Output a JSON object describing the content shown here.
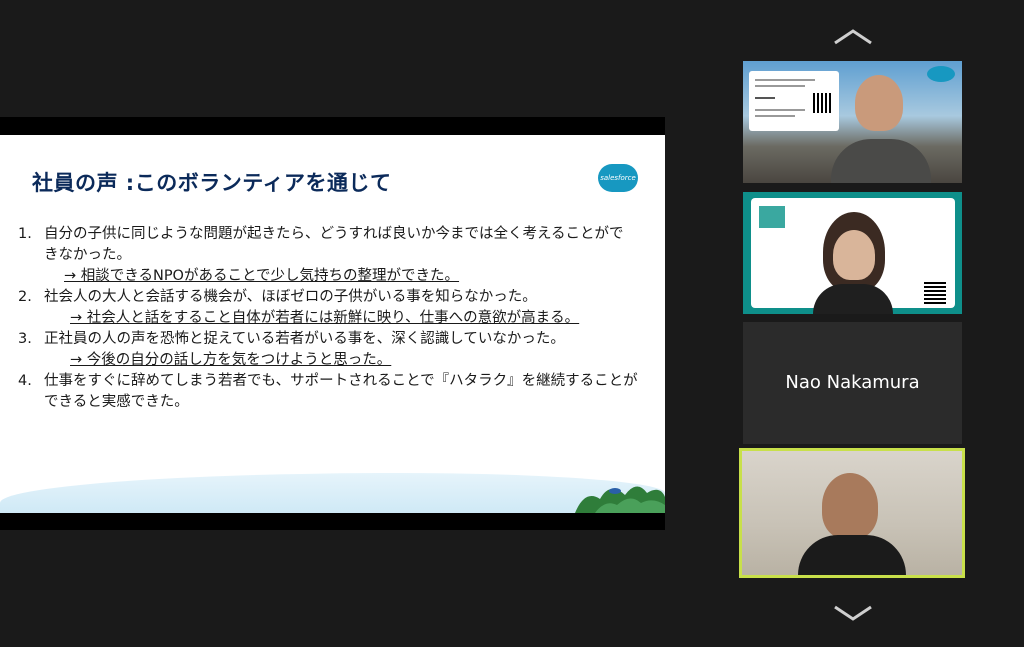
{
  "slide": {
    "title": "社員の声 :このボランティアを通じて",
    "logo_text": "salesforce",
    "items": [
      {
        "num": "1.",
        "text": "自分の子供に同じような問題が起きたら、どうすれば良いか今までは全く考えることができなかった。",
        "sub": "→ 相談できるNPOがあることで少し気持ちの整理ができた。"
      },
      {
        "num": "2.",
        "text": "社会人の大人と会話する機会が、ほぼゼロの子供がいる事を知らなかった。",
        "sub": "→ 社会人と話をすること自体が若者には新鮮に映り、仕事への意欲が高まる。"
      },
      {
        "num": "3.",
        "text": "正社員の人の声を恐怖と捉えている若者がいる事を、深く認識していなかった。",
        "sub": "→ 今後の自分の話し方を気をつけようと思った。"
      },
      {
        "num": "4.",
        "text": "仕事をすぐに辞めてしまう若者でも、サポートされることで『ハタラク』を継続することができると実感できた。",
        "sub": ""
      }
    ]
  },
  "participants": {
    "tile3_name": "Nao Nakamura"
  },
  "colors": {
    "accent_active": "#c8e04a",
    "slide_title": "#0b2a5a",
    "background": "#1a1a1a"
  }
}
